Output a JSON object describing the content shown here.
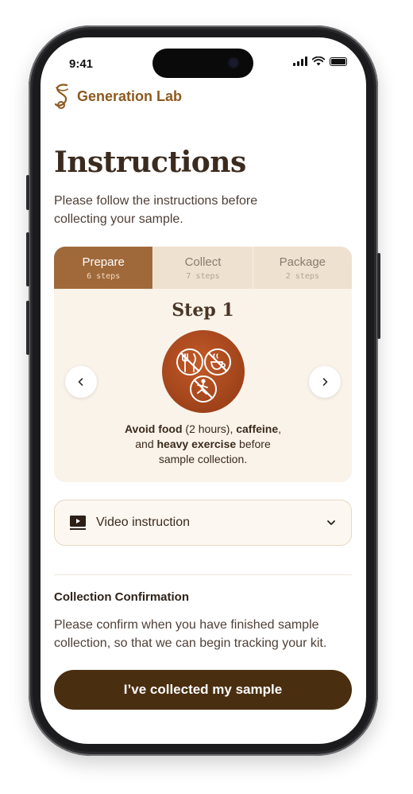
{
  "status_bar": {
    "time": "9:41"
  },
  "brand": {
    "name": "Generation Lab",
    "logo_icon": "generation-lab-logo"
  },
  "page": {
    "title": "Instructions",
    "subtitle": "Please follow the instructions before collecting your sample."
  },
  "tabs": [
    {
      "label": "Prepare",
      "sub": "6 steps",
      "active": true
    },
    {
      "label": "Collect",
      "sub": "7 steps",
      "active": false
    },
    {
      "label": "Package",
      "sub": "2 steps",
      "active": false
    }
  ],
  "step": {
    "title": "Step 1",
    "text_parts": {
      "p1": "Avoid food",
      "p2": " (2 hours), ",
      "p3": "caffeine",
      "p4": ",",
      "p5": "and ",
      "p6": "heavy exercise",
      "p7": " before",
      "p8": "sample collection."
    },
    "illustration_icons": [
      "no-food-icon",
      "no-caffeine-icon",
      "no-exercise-icon"
    ],
    "nav": {
      "prev_icon": "chevron-left-icon",
      "next_icon": "chevron-right-icon"
    }
  },
  "video": {
    "label": "Video instruction",
    "icon": "video-play-icon",
    "expand_icon": "chevron-down-icon"
  },
  "confirmation": {
    "title": "Collection Confirmation",
    "text": "Please confirm when you have finished sample collection, so that we can begin tracking your kit.",
    "button_label": "I’ve collected my sample"
  },
  "colors": {
    "brand": "#8d5a1f",
    "tab_active": "#a0693a",
    "card_bg": "#faf3ea",
    "cta_bg": "#4a2e10",
    "illustration": "#b04e22"
  }
}
